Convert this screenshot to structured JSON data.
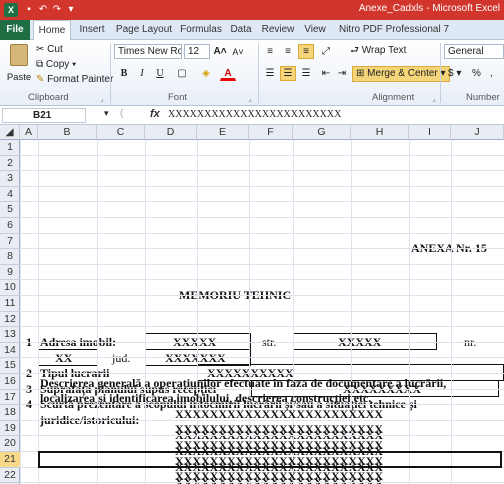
{
  "window": {
    "title": "Anexe_Cadxls - Microsoft Excel"
  },
  "ribbon_tabs": [
    "File",
    "Home",
    "Insert",
    "Page Layout",
    "Formulas",
    "Data",
    "Review",
    "View",
    "Nitro PDF Professional 7"
  ],
  "clipboard": {
    "paste": "Paste",
    "cut": "Cut",
    "copy": "Copy",
    "format_painter": "Format Painter",
    "group": "Clipboard"
  },
  "font": {
    "name": "Times New Roma",
    "size": "12",
    "bold": "B",
    "italic": "I",
    "underline": "U",
    "group": "Font"
  },
  "alignment": {
    "wrap_text": "Wrap Text",
    "merge_center": "Merge & Center",
    "group": "Alignment"
  },
  "number": {
    "format": "General",
    "currency": "$",
    "percent": "%",
    "comma": ",",
    "group": "Number"
  },
  "formula_bar": {
    "cell_ref": "B21",
    "fx": "fx",
    "content": "XXXXXXXXXXXXXXXXXXXXXXXX"
  },
  "columns": [
    "A",
    "B",
    "C",
    "D",
    "E",
    "F",
    "G",
    "H",
    "I",
    "J"
  ],
  "rows": [
    "1",
    "2",
    "3",
    "4",
    "5",
    "6",
    "7",
    "8",
    "9",
    "10",
    "11",
    "12",
    "13",
    "14",
    "15",
    "16",
    "17",
    "18",
    "19",
    "20",
    "21",
    "22"
  ],
  "selected_row": "21",
  "sheet": {
    "anexa": "ANEXA Nr. 15",
    "title": "MEMORIU TEHNIC",
    "r6_num": "1",
    "r6_label": "Adresa imobil:",
    "r6_val1": "XXXXX",
    "r6_str": "str.",
    "r6_val2": "XXXXX",
    "r6_nr": "nr.",
    "r7_val1": "XX",
    "r7_jud": "jud.",
    "r7_val2": "XXXXXXX",
    "r8_num": "2",
    "r8_label": "Tipul lucrarii",
    "r8_val": "XXXXXXXXXX",
    "r9_num": "3",
    "r9_label": "Suprafața planului supus recepției",
    "r9_val": "XXXXXXXXX",
    "r10_num": "4",
    "r10_label": "Scurtă prezentare a scopului întocmirii lucrării și/sau a situației tehnice și",
    "r11_label": "juridice/istoricului:",
    "r12": "XXXXXXXXXXXXXXXXXXXXXXXX",
    "r13": "XXXXXXXXXXXXXXXXXXXXXXXX",
    "r14": "XXXXXXXXXXXXXXXXXXXXXXXX",
    "r15": "XXXXXXXXXXXXXXXXXXXXXXXX",
    "r16_num": "5",
    "r16_label": "Descrierea generală a operațiunilor efectuate în faza de documentare a lucrării,",
    "r17_label": "localizarea și identificarea imobilului, descrierea construcției etc.",
    "r18": "XXXXXXXXXXXXXXXXXXXXXXXX",
    "r19": "XXXXXXXXXXXXXXXXXXXXXXXX",
    "r20": "XXXXXXXXXXXXXXXXXXXXXXXX",
    "r21": "XXXXXXXXXXXXXXXXXXXXXXXX",
    "r22": "XXXXXXXXXXXXXXXXXXXXXXXX"
  }
}
